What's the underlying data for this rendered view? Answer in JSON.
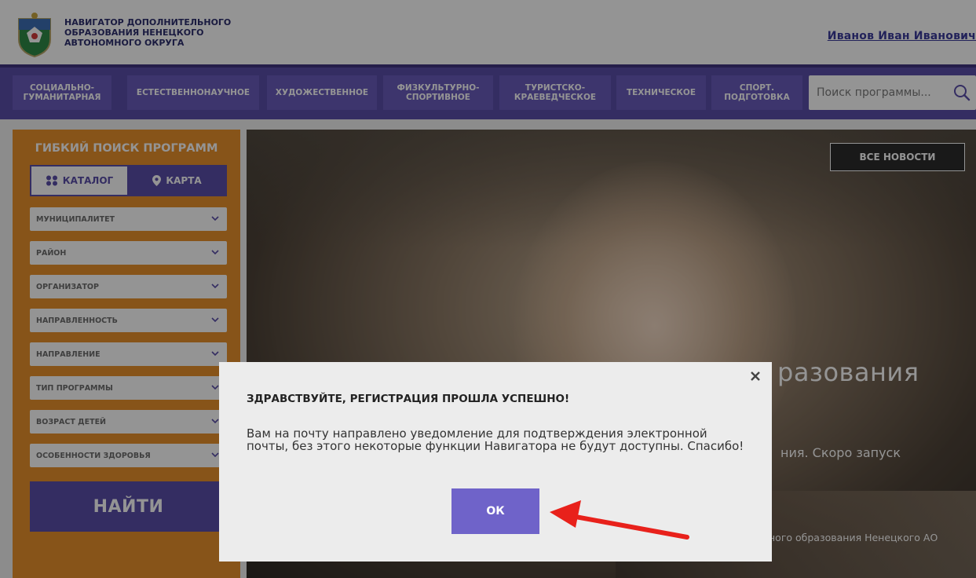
{
  "header": {
    "site_title": "НАВИГАТОР ДОПОЛНИТЕЛЬНОГО ОБРАЗОВАНИЯ НЕНЕЦКОГО АВТОНОМНОГО ОКРУГА",
    "user_name": "Иванов Иван Иванович"
  },
  "nav": {
    "items": [
      {
        "label": "СОЦИАЛЬНО-ГУМАНИТАРНАЯ"
      },
      {
        "label": "ЕСТЕСТВЕННОНАУЧНОЕ"
      },
      {
        "label": "ХУДОЖЕСТВЕННОЕ"
      },
      {
        "label": "ФИЗКУЛЬТУРНО-СПОРТИВНОЕ"
      },
      {
        "label": "ТУРИСТСКО-КРАЕВЕДЧЕСКОЕ"
      },
      {
        "label": "ТЕХНИЧЕСКОЕ"
      },
      {
        "label": "СПОРТ. ПОДГОТОВКА"
      }
    ],
    "search_placeholder": "Поиск программы..."
  },
  "sidebar": {
    "title": "ГИБКИЙ ПОИСК ПРОГРАММ",
    "tab_catalog": "КАТАЛОГ",
    "tab_map": "КАРТА",
    "filters": [
      {
        "label": "МУНИЦИПАЛИТЕТ"
      },
      {
        "label": "РАЙОН"
      },
      {
        "label": "ОРГАНИЗАТОР"
      },
      {
        "label": "НАПРАВЛЕННОСТЬ"
      },
      {
        "label": "НАПРАВЛЕНИЕ"
      },
      {
        "label": "ТИП ПРОГРАММЫ"
      },
      {
        "label": "ВОЗРАСТ ДЕТЕЙ"
      },
      {
        "label": "ОСОБЕННОСТИ ЗДОРОВЬЯ"
      }
    ],
    "find_button": "НАЙТИ"
  },
  "hero": {
    "news_button": "ВСЕ НОВОСТИ",
    "title_fragment": "разования",
    "subtitle_fragment": "ния. Скоро запуск",
    "footer_fragment": "ного образования Ненецкого АО"
  },
  "modal": {
    "title": "ЗДРАВСТВУЙТЕ, РЕГИСТРАЦИЯ ПРОШЛА УСПЕШНО!",
    "message": "Вам на почту направлено уведомление для подтверждения электронной почты,  без этого некоторые функции Навигатора не будут доступны. Спасибо!",
    "ok_label": "ОК"
  },
  "colors": {
    "brand_purple": "#5b4ea9",
    "sidebar_orange": "#e9912c",
    "ok_button": "#6f63c9",
    "annotation_arrow": "#e8211b"
  }
}
